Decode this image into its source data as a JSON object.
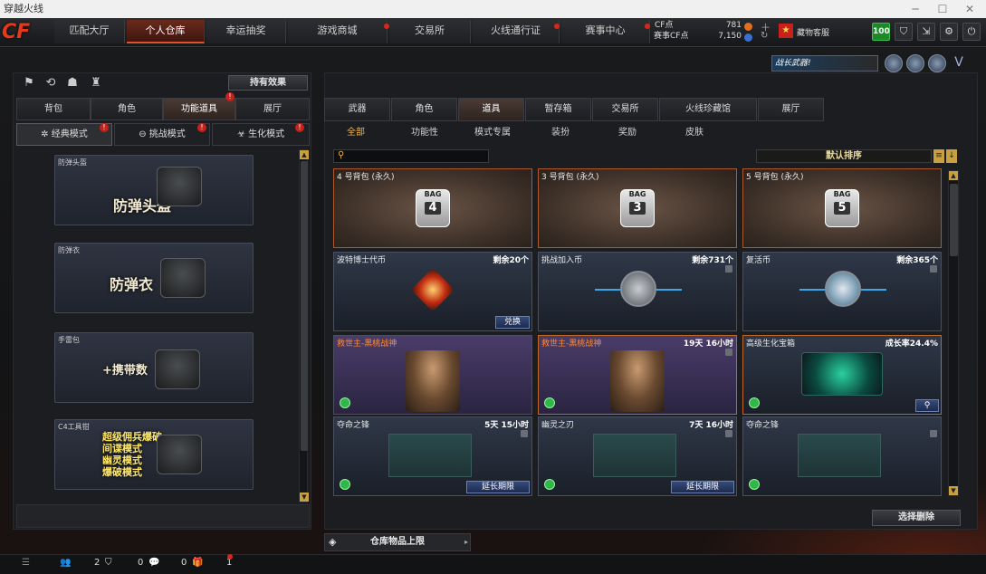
{
  "window": {
    "title": "穿越火线"
  },
  "topnav": {
    "logo": "CF",
    "tabs": [
      {
        "label": "匹配大厅"
      },
      {
        "label": "个人仓库",
        "active": true
      },
      {
        "label": "幸运抽奖"
      },
      {
        "label": "游戏商城"
      },
      {
        "label": "交易所"
      },
      {
        "label": "火线通行证"
      },
      {
        "label": "赛事中心"
      }
    ],
    "cf_label": "CF点",
    "cf_value": "781",
    "match_cf_label": "赛事CF点",
    "match_cf_value": "7,150",
    "service_label": "藏物客服",
    "level_badge": "100"
  },
  "banner": {
    "text": "战长武器!"
  },
  "left": {
    "effect_button": "持有效果",
    "tabs": [
      "背包",
      "角色",
      "功能道具",
      "展厅"
    ],
    "modes": [
      "经典模式",
      "挑战模式",
      "生化模式"
    ],
    "cards": [
      {
        "caption": "防弹头盔",
        "title": "防弹头盔"
      },
      {
        "caption": "防弹衣",
        "title": "防弹衣"
      },
      {
        "caption": "手雷包",
        "title": "+携带数"
      },
      {
        "caption": "C4工具钳",
        "lines": [
          "超级佣兵爆破",
          "间谍模式",
          "幽灵模式",
          "爆破模式"
        ]
      }
    ]
  },
  "right": {
    "tabs": [
      "武器",
      "角色",
      "道具",
      "暂存箱",
      "交易所",
      "火线珍藏馆",
      "展厅"
    ],
    "filters": [
      "全部",
      "功能性",
      "模式专属",
      "装扮",
      "奖励",
      "皮肤"
    ],
    "sort_label": "默认排序",
    "items": [
      {
        "name": "4 号背包 (永久)",
        "badge_number": "4",
        "badge_text": "BAG"
      },
      {
        "name": "3 号背包 (永久)",
        "badge_number": "3",
        "badge_text": "BAG"
      },
      {
        "name": "5 号背包 (永久)",
        "badge_number": "5",
        "badge_text": "BAG"
      },
      {
        "name": "波特博士代币",
        "remain": "剩余20个",
        "action": "兑换"
      },
      {
        "name": "挑战加入币",
        "remain": "剩余731个"
      },
      {
        "name": "复活币",
        "remain": "剩余365个"
      },
      {
        "name": "救世主-黑桃战神"
      },
      {
        "name": "救世主-黑桃战神",
        "remain": "19天 16小时"
      },
      {
        "name": "高级生化宝箱",
        "remain": "成长率24.4%"
      },
      {
        "name": "夺命之锋",
        "remain": "5天 15小时",
        "action": "延长期限"
      },
      {
        "name": "幽灵之刃",
        "remain": "7天 16小时",
        "action": "延长期限"
      },
      {
        "name": "夺命之锋"
      }
    ],
    "delete_button": "选择删除",
    "capacity_label": "仓库物品上限"
  },
  "statusbar": {
    "friends": "2",
    "messages": "0",
    "gifts": "0",
    "alerts": "1"
  },
  "colors": {
    "accent": "#e0502a",
    "gold": "#f0b64a",
    "panel": "#1c1d20"
  }
}
